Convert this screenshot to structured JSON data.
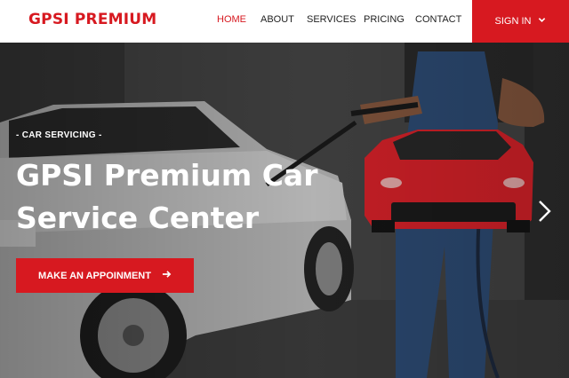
{
  "header": {
    "logo": "GPSI PREMIUM",
    "nav": [
      {
        "label": "HOME",
        "active": true
      },
      {
        "label": "ABOUT",
        "active": false
      },
      {
        "label": "SERVICES",
        "active": false
      },
      {
        "label": "PRICING",
        "active": false
      },
      {
        "label": "CONTACT",
        "active": false
      }
    ],
    "signin_label": "SIGN IN",
    "signin_icon": "chevron-down-icon"
  },
  "hero": {
    "eyebrow": "- CAR SERVICING -",
    "headline": "GPSI Premium Car Service Center",
    "cta_label": "MAKE AN APPOINMENT",
    "cta_icon": "arrow-right-icon",
    "next_icon": "chevron-right-icon"
  },
  "colors": {
    "brand": "#d71920",
    "header_bg": "#ffffff",
    "nav_text": "#222222",
    "hero_text": "#ffffff"
  }
}
